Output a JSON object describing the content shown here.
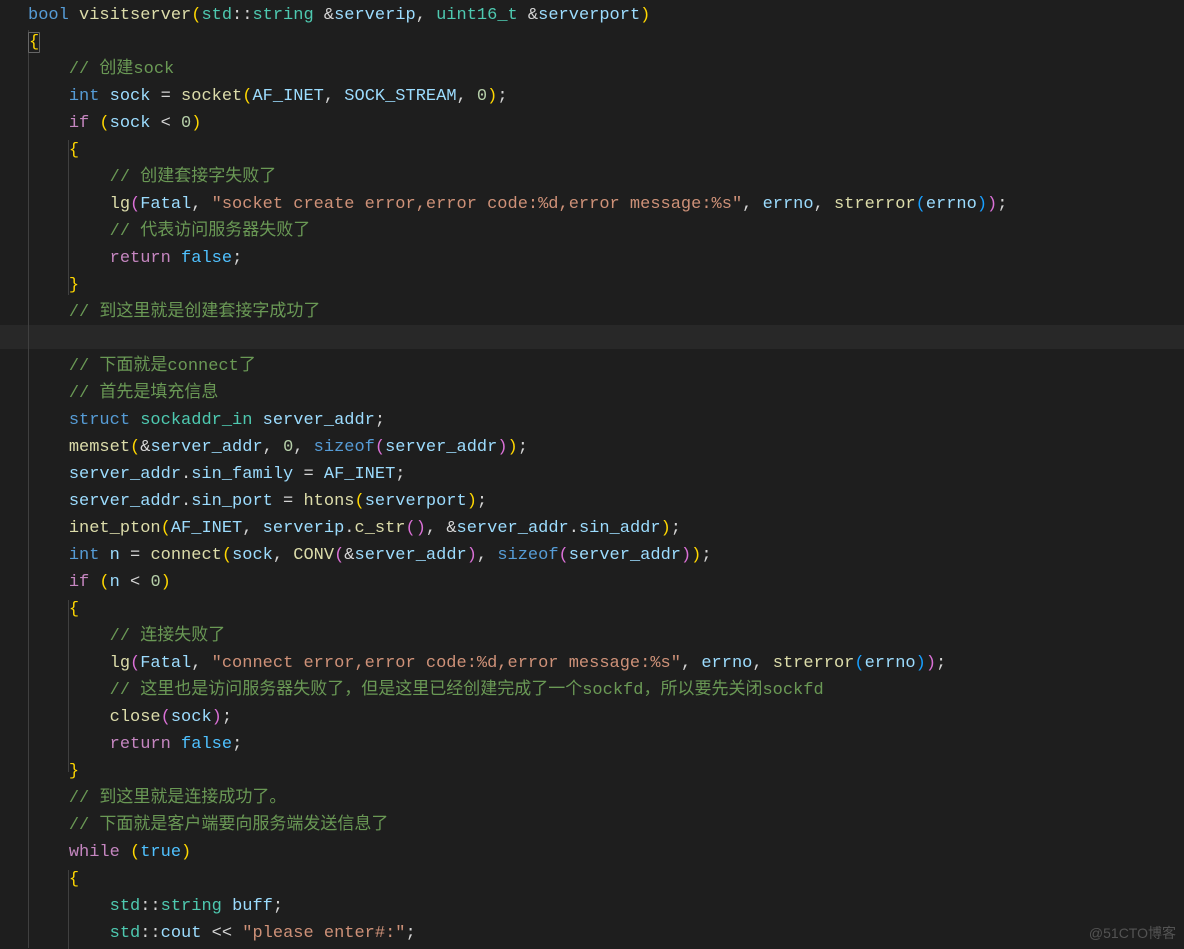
{
  "watermark": "@51CTO博客",
  "tokens": [
    [
      [
        "kw",
        "bool"
      ],
      [
        "op",
        " "
      ],
      [
        "fn",
        "visitserver"
      ],
      [
        "gold",
        "("
      ],
      [
        "typ",
        "std"
      ],
      [
        "op",
        "::"
      ],
      [
        "typ",
        "string"
      ],
      [
        "op",
        " &"
      ],
      [
        "var",
        "serverip"
      ],
      [
        "op",
        ", "
      ],
      [
        "typ",
        "uint16_t"
      ],
      [
        "op",
        " &"
      ],
      [
        "var",
        "serverport"
      ],
      [
        "gold",
        ")"
      ]
    ],
    [
      [
        "bracehl",
        "{"
      ]
    ],
    [
      [
        "op",
        "    "
      ],
      [
        "com",
        "// 创建sock"
      ]
    ],
    [
      [
        "op",
        "    "
      ],
      [
        "kw",
        "int"
      ],
      [
        "op",
        " "
      ],
      [
        "var",
        "sock"
      ],
      [
        "op",
        " = "
      ],
      [
        "fn",
        "socket"
      ],
      [
        "gold",
        "("
      ],
      [
        "var",
        "AF_INET"
      ],
      [
        "op",
        ", "
      ],
      [
        "var",
        "SOCK_STREAM"
      ],
      [
        "op",
        ", "
      ],
      [
        "num",
        "0"
      ],
      [
        "gold",
        ")"
      ],
      [
        "op",
        ";"
      ]
    ],
    [
      [
        "op",
        "    "
      ],
      [
        "ctl",
        "if"
      ],
      [
        "op",
        " "
      ],
      [
        "gold",
        "("
      ],
      [
        "var",
        "sock"
      ],
      [
        "op",
        " < "
      ],
      [
        "num",
        "0"
      ],
      [
        "gold",
        ")"
      ]
    ],
    [
      [
        "op",
        "    "
      ],
      [
        "gold",
        "{"
      ]
    ],
    [
      [
        "op",
        "        "
      ],
      [
        "com",
        "// 创建套接字失败了"
      ]
    ],
    [
      [
        "op",
        "        "
      ],
      [
        "fn",
        "lg"
      ],
      [
        "pk",
        "("
      ],
      [
        "var",
        "Fatal"
      ],
      [
        "op",
        ", "
      ],
      [
        "str",
        "\"socket create error,error code:%d,error message:%s\""
      ],
      [
        "op",
        ", "
      ],
      [
        "var",
        "errno"
      ],
      [
        "op",
        ", "
      ],
      [
        "fn",
        "strerror"
      ],
      [
        "bl",
        "("
      ],
      [
        "var",
        "errno"
      ],
      [
        "bl",
        ")"
      ],
      [
        "pk",
        ")"
      ],
      [
        "op",
        ";"
      ]
    ],
    [
      [
        "op",
        "        "
      ],
      [
        "com",
        "// 代表访问服务器失败了"
      ]
    ],
    [
      [
        "op",
        "        "
      ],
      [
        "ctl",
        "return"
      ],
      [
        "op",
        " "
      ],
      [
        "con",
        "false"
      ],
      [
        "op",
        ";"
      ]
    ],
    [
      [
        "op",
        "    "
      ],
      [
        "gold",
        "}"
      ]
    ],
    [
      [
        "op",
        "    "
      ],
      [
        "com",
        "// 到这里就是创建套接字成功了"
      ]
    ],
    [],
    [
      [
        "op",
        "    "
      ],
      [
        "com",
        "// 下面就是connect了"
      ]
    ],
    [
      [
        "op",
        "    "
      ],
      [
        "com",
        "// 首先是填充信息"
      ]
    ],
    [
      [
        "op",
        "    "
      ],
      [
        "kw",
        "struct"
      ],
      [
        "op",
        " "
      ],
      [
        "typ",
        "sockaddr_in"
      ],
      [
        "op",
        " "
      ],
      [
        "var",
        "server_addr"
      ],
      [
        "op",
        ";"
      ]
    ],
    [
      [
        "op",
        "    "
      ],
      [
        "fn",
        "memset"
      ],
      [
        "gold",
        "("
      ],
      [
        "op",
        "&"
      ],
      [
        "var",
        "server_addr"
      ],
      [
        "op",
        ", "
      ],
      [
        "num",
        "0"
      ],
      [
        "op",
        ", "
      ],
      [
        "kw",
        "sizeof"
      ],
      [
        "pk",
        "("
      ],
      [
        "var",
        "server_addr"
      ],
      [
        "pk",
        ")"
      ],
      [
        "gold",
        ")"
      ],
      [
        "op",
        ";"
      ]
    ],
    [
      [
        "op",
        "    "
      ],
      [
        "var",
        "server_addr"
      ],
      [
        "op",
        "."
      ],
      [
        "var",
        "sin_family"
      ],
      [
        "op",
        " = "
      ],
      [
        "var",
        "AF_INET"
      ],
      [
        "op",
        ";"
      ]
    ],
    [
      [
        "op",
        "    "
      ],
      [
        "var",
        "server_addr"
      ],
      [
        "op",
        "."
      ],
      [
        "var",
        "sin_port"
      ],
      [
        "op",
        " = "
      ],
      [
        "fn",
        "htons"
      ],
      [
        "gold",
        "("
      ],
      [
        "var",
        "serverport"
      ],
      [
        "gold",
        ")"
      ],
      [
        "op",
        ";"
      ]
    ],
    [
      [
        "op",
        "    "
      ],
      [
        "fn",
        "inet_pton"
      ],
      [
        "gold",
        "("
      ],
      [
        "var",
        "AF_INET"
      ],
      [
        "op",
        ", "
      ],
      [
        "var",
        "serverip"
      ],
      [
        "op",
        "."
      ],
      [
        "fn",
        "c_str"
      ],
      [
        "pk",
        "("
      ],
      [
        "pk",
        ")"
      ],
      [
        "op",
        ", &"
      ],
      [
        "var",
        "server_addr"
      ],
      [
        "op",
        "."
      ],
      [
        "var",
        "sin_addr"
      ],
      [
        "gold",
        ")"
      ],
      [
        "op",
        ";"
      ]
    ],
    [
      [
        "op",
        "    "
      ],
      [
        "kw",
        "int"
      ],
      [
        "op",
        " "
      ],
      [
        "var",
        "n"
      ],
      [
        "op",
        " = "
      ],
      [
        "fn",
        "connect"
      ],
      [
        "gold",
        "("
      ],
      [
        "var",
        "sock"
      ],
      [
        "op",
        ", "
      ],
      [
        "fn",
        "CONV"
      ],
      [
        "pk",
        "("
      ],
      [
        "op",
        "&"
      ],
      [
        "var",
        "server_addr"
      ],
      [
        "pk",
        ")"
      ],
      [
        "op",
        ", "
      ],
      [
        "kw",
        "sizeof"
      ],
      [
        "pk",
        "("
      ],
      [
        "var",
        "server_addr"
      ],
      [
        "pk",
        ")"
      ],
      [
        "gold",
        ")"
      ],
      [
        "op",
        ";"
      ]
    ],
    [
      [
        "op",
        "    "
      ],
      [
        "ctl",
        "if"
      ],
      [
        "op",
        " "
      ],
      [
        "gold",
        "("
      ],
      [
        "var",
        "n"
      ],
      [
        "op",
        " < "
      ],
      [
        "num",
        "0"
      ],
      [
        "gold",
        ")"
      ]
    ],
    [
      [
        "op",
        "    "
      ],
      [
        "gold",
        "{"
      ]
    ],
    [
      [
        "op",
        "        "
      ],
      [
        "com",
        "// 连接失败了"
      ]
    ],
    [
      [
        "op",
        "        "
      ],
      [
        "fn",
        "lg"
      ],
      [
        "pk",
        "("
      ],
      [
        "var",
        "Fatal"
      ],
      [
        "op",
        ", "
      ],
      [
        "str",
        "\"connect error,error code:%d,error message:%s\""
      ],
      [
        "op",
        ", "
      ],
      [
        "var",
        "errno"
      ],
      [
        "op",
        ", "
      ],
      [
        "fn",
        "strerror"
      ],
      [
        "bl",
        "("
      ],
      [
        "var",
        "errno"
      ],
      [
        "bl",
        ")"
      ],
      [
        "pk",
        ")"
      ],
      [
        "op",
        ";"
      ]
    ],
    [
      [
        "op",
        "        "
      ],
      [
        "com",
        "// 这里也是访问服务器失败了，但是这里已经创建完成了一个sockfd，所以要先关闭sockfd"
      ]
    ],
    [
      [
        "op",
        "        "
      ],
      [
        "fn",
        "close"
      ],
      [
        "pk",
        "("
      ],
      [
        "var",
        "sock"
      ],
      [
        "pk",
        ")"
      ],
      [
        "op",
        ";"
      ]
    ],
    [
      [
        "op",
        "        "
      ],
      [
        "ctl",
        "return"
      ],
      [
        "op",
        " "
      ],
      [
        "con",
        "false"
      ],
      [
        "op",
        ";"
      ]
    ],
    [
      [
        "op",
        "    "
      ],
      [
        "gold",
        "}"
      ]
    ],
    [
      [
        "op",
        "    "
      ],
      [
        "com",
        "// 到这里就是连接成功了。"
      ]
    ],
    [
      [
        "op",
        "    "
      ],
      [
        "com",
        "// 下面就是客户端要向服务端发送信息了"
      ]
    ],
    [
      [
        "op",
        "    "
      ],
      [
        "ctl",
        "while"
      ],
      [
        "op",
        " "
      ],
      [
        "gold",
        "("
      ],
      [
        "con",
        "true"
      ],
      [
        "gold",
        ")"
      ]
    ],
    [
      [
        "op",
        "    "
      ],
      [
        "gold",
        "{"
      ]
    ],
    [
      [
        "op",
        "        "
      ],
      [
        "typ",
        "std"
      ],
      [
        "op",
        "::"
      ],
      [
        "typ",
        "string"
      ],
      [
        "op",
        " "
      ],
      [
        "var",
        "buff"
      ],
      [
        "op",
        ";"
      ]
    ],
    [
      [
        "op",
        "        "
      ],
      [
        "typ",
        "std"
      ],
      [
        "op",
        "::"
      ],
      [
        "var",
        "cout"
      ],
      [
        "op",
        " << "
      ],
      [
        "str",
        "\"please enter#:\""
      ],
      [
        "op",
        ";"
      ]
    ]
  ]
}
